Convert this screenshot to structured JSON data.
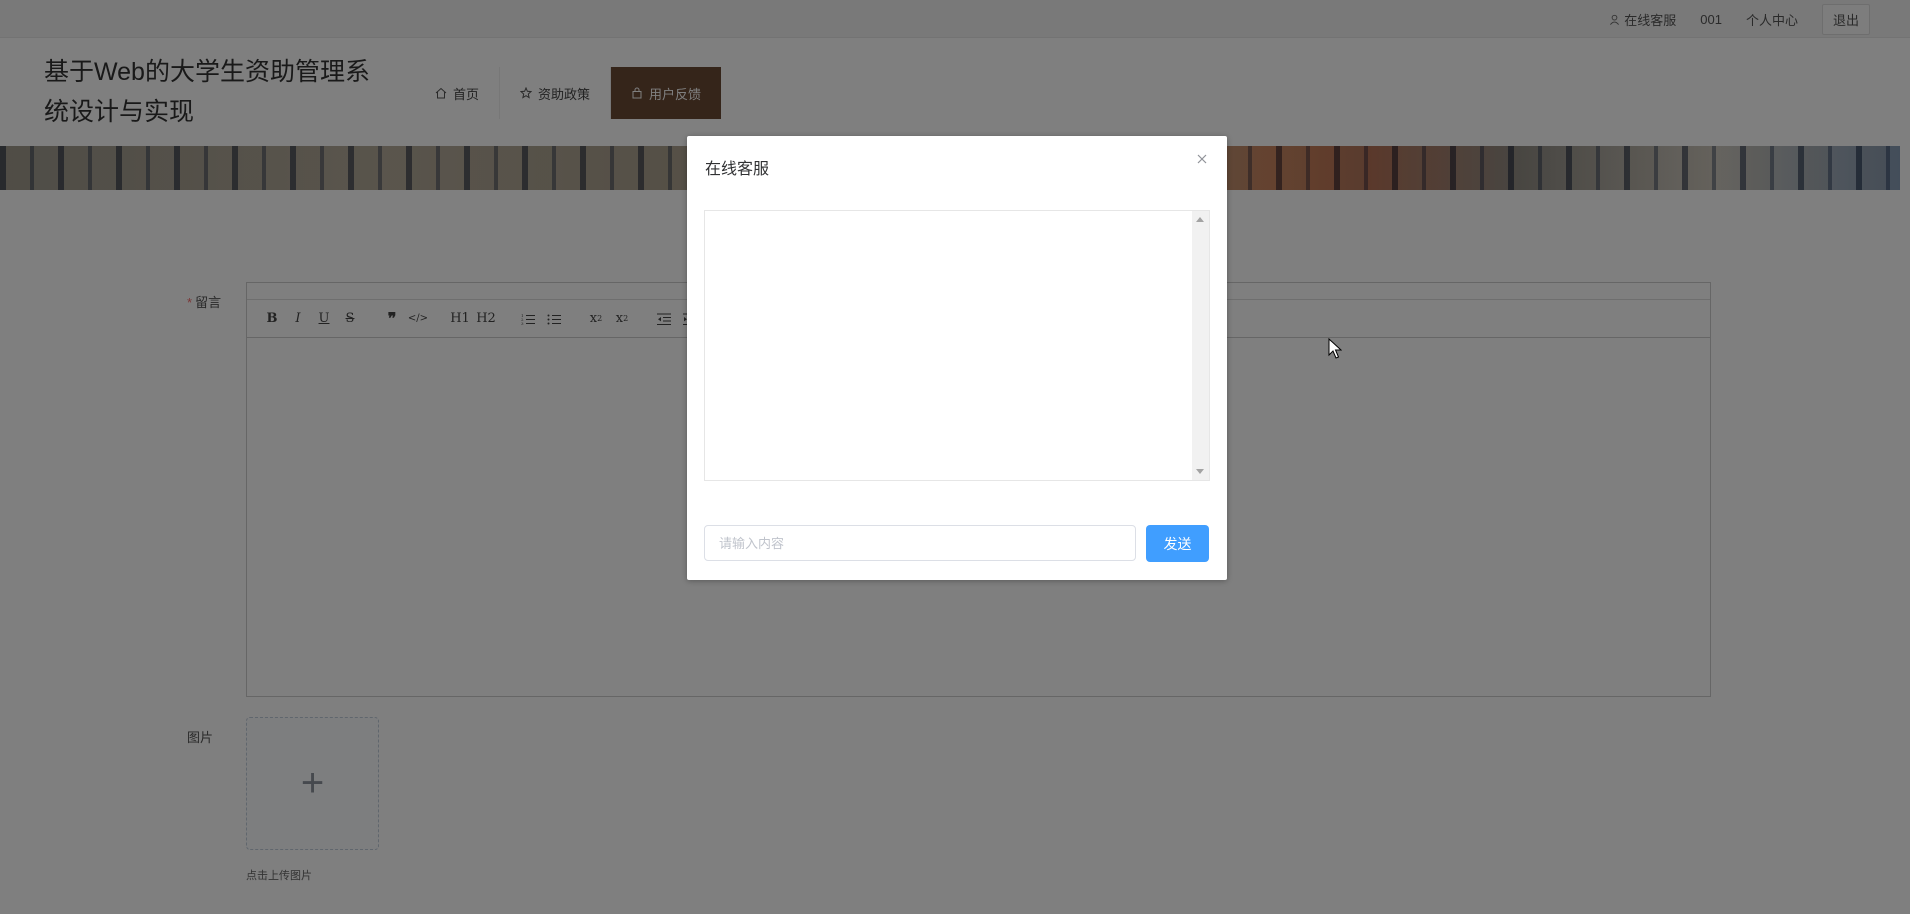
{
  "topbar": {
    "service": "在线客服",
    "username": "001",
    "profile": "个人中心",
    "logout": "退出"
  },
  "header": {
    "title": "基于Web的大学生资助管理系统设计与实现",
    "nav": [
      {
        "label": "首页",
        "icon": "home-icon"
      },
      {
        "label": "资助政策",
        "icon": "star-icon"
      },
      {
        "label": "用户反馈",
        "icon": "bag-icon",
        "active": true
      }
    ]
  },
  "form": {
    "message_label": "留言",
    "image_label": "图片",
    "upload_tip": "点击上传图片",
    "toolbar": [
      "B",
      "I",
      "U",
      "S",
      "❞",
      "</>",
      "H1",
      "H2",
      "ol",
      "ul",
      "x2",
      "x²",
      "outdent",
      "indent"
    ]
  },
  "dialog": {
    "title": "在线客服",
    "input_placeholder": "请输入内容",
    "send_label": "发送"
  },
  "colors": {
    "accent": "#409eff",
    "nav_active": "#6b4a35",
    "required": "#f56c6c"
  }
}
